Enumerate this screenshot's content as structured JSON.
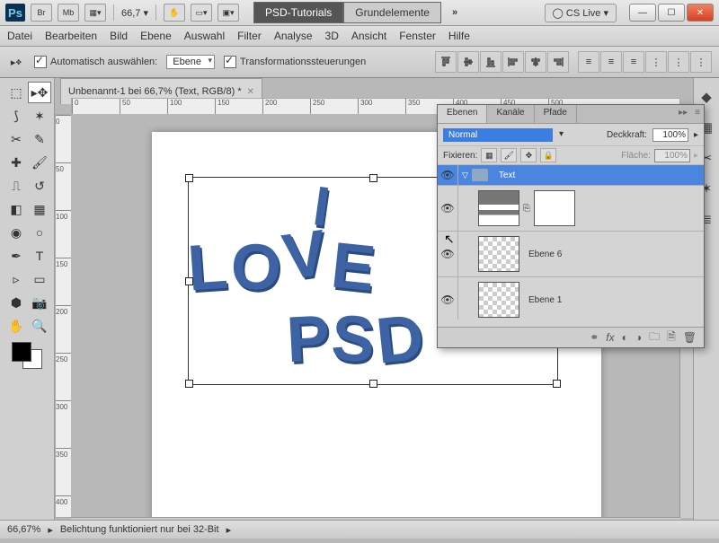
{
  "titlebar": {
    "zoom": "66,7",
    "tab1": "PSD-Tutorials",
    "tab2": "Grundelemente",
    "cslive": "CS Live"
  },
  "menu": {
    "items": [
      "Datei",
      "Bearbeiten",
      "Bild",
      "Ebene",
      "Auswahl",
      "Filter",
      "Analyse",
      "3D",
      "Ansicht",
      "Fenster",
      "Hilfe"
    ]
  },
  "options": {
    "auto": "Automatisch auswählen:",
    "autodd": "Ebene",
    "transform": "Transformationssteuerungen"
  },
  "doc": {
    "tab": "Unbenannt-1 bei 66,7% (Text, RGB/8) *"
  },
  "ruler_h": [
    "0",
    "50",
    "100",
    "150",
    "200",
    "250",
    "300",
    "350",
    "400",
    "450",
    "500"
  ],
  "ruler_v": [
    "0",
    "50",
    "100",
    "150",
    "200",
    "250",
    "300",
    "350",
    "400"
  ],
  "art": {
    "line1": "I",
    "line2": "LOVE",
    "line3": "PSD"
  },
  "panel": {
    "tabs": [
      "Ebenen",
      "Kanäle",
      "Pfade"
    ],
    "blend": "Normal",
    "opacity_label": "Deckkraft:",
    "opacity": "100%",
    "lock": "Fixieren:",
    "fill_label": "Fläche:",
    "fill": "100%",
    "group": "Text",
    "layers": [
      {
        "name": "Ebene 6"
      },
      {
        "name": "Ebene 1"
      }
    ]
  },
  "status": {
    "zoom": "66,67%",
    "msg": "Belichtung funktioniert nur bei 32-Bit"
  }
}
